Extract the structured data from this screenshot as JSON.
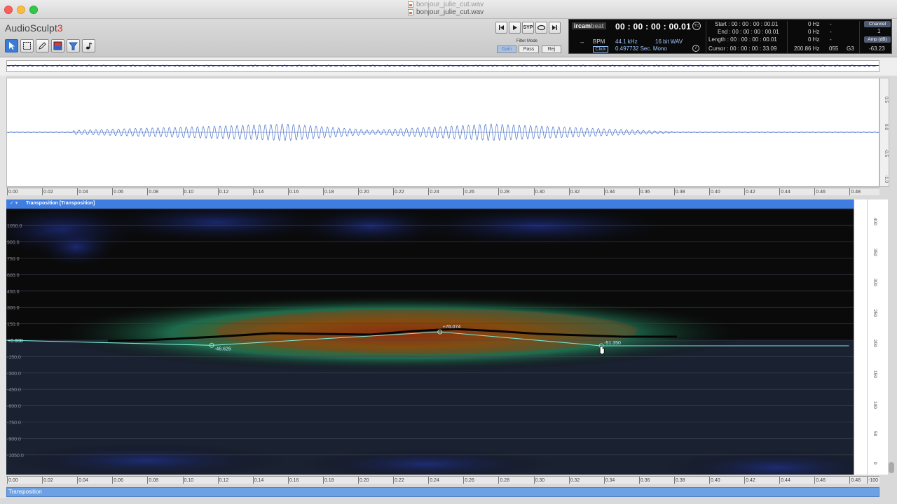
{
  "window": {
    "titles": [
      "bonjour_julie_cut.wav",
      "bonjour_julie_cut.wav"
    ]
  },
  "app": {
    "name": "AudioSculpt",
    "version": "3"
  },
  "toolbar": {
    "tools": [
      "select-arrow-icon",
      "rect-select-icon",
      "pencil-icon",
      "color-rect-icon",
      "filter-icon",
      "note-icon"
    ],
    "transport": [
      "skip-back-icon",
      "play-icon",
      "SYP",
      "loop-icon",
      "skip-forward-icon"
    ],
    "transport_labels": {
      "syp": "SYP"
    },
    "filter_mode": {
      "label": "Filter Mode",
      "buttons": [
        "Gain",
        "Pass",
        "Rej"
      ],
      "active": "Gain"
    }
  },
  "display": {
    "brand": "ircam",
    "brand_suffix": "beat",
    "timecode": "00 : 00 : 00 : 00.01",
    "tc_badge": "TC",
    "bpm_dash": "--",
    "bpm_label": "BPM",
    "click_label": "Click",
    "sample_rate": "44.1 kHz",
    "bit_depth": "16 bit WAV",
    "duration": "0.497732 Sec. Mono",
    "start": "Start : 00 : 00 : 00 : 00.01",
    "end": "End : 00 : 00 : 00 : 00.01",
    "length": "Length : 00 : 00 : 00 : 00.01",
    "cursor": "Cursor : 00 : 00 : 00 : 33.09",
    "start_hz": "0 Hz",
    "end_hz": "0 Hz",
    "length_hz": "0 Hz",
    "cursor_hz": "200.86 Hz",
    "cursor_midi": "055",
    "cursor_note": "G3",
    "dash": "-",
    "channel_label": "Channel",
    "channel_value": "1",
    "amp_label": "Amp (dB)",
    "amp_value": "-63.23"
  },
  "waveform": {
    "scale_labels": [
      "0.5",
      "0.0",
      "-0.5",
      "-1.0"
    ]
  },
  "time_ruler": [
    "0.00",
    "0.02",
    "0.04",
    "0.06",
    "0.08",
    "0.10",
    "0.12",
    "0.14",
    "0.16",
    "0.18",
    "0.20",
    "0.22",
    "0.24",
    "0.26",
    "0.28",
    "0.30",
    "0.32",
    "0.34",
    "0.36",
    "0.38",
    "0.40",
    "0.42",
    "0.44",
    "0.46",
    "0.48"
  ],
  "bottom_ruler": [
    "0.00",
    "0.02",
    "0.04",
    "0.06",
    "0.08",
    "0.10",
    "0.12",
    "0.14",
    "0.16",
    "0.18",
    "0.20",
    "0.22",
    "0.24",
    "0.26",
    "0.28",
    "0.30",
    "0.32",
    "0.34",
    "0.36",
    "0.38",
    "0.40",
    "0.42",
    "0.44",
    "0.46",
    "0.48",
    "-100"
  ],
  "spectrogram": {
    "header_label": "Transposition [Transposition]",
    "y_labels": [
      "1050.0",
      "900.0",
      "750.0",
      "600.0",
      "450.0",
      "300.0",
      "150.0",
      "+0.000",
      "-150.0",
      "-300.0",
      "-450.0",
      "-600.0",
      "-750.0",
      "-900.0",
      "-1050.0"
    ],
    "right_scale": [
      "400",
      "350",
      "300",
      "250",
      "200",
      "150",
      "100",
      "50",
      "0"
    ],
    "breakpoints": [
      {
        "t": 0.0,
        "cents": 0.0,
        "label": "+0.000"
      },
      {
        "t": 0.117,
        "cents": -46.626,
        "label": "-46.626"
      },
      {
        "t": 0.247,
        "cents": 76.074,
        "label": "+76.074"
      },
      {
        "t": 0.339,
        "cents": -51.35,
        "label": "-51.350"
      },
      {
        "t": 0.48,
        "cents": -51.35,
        "label": ""
      }
    ],
    "line_color": "#7fe6d6"
  },
  "status": {
    "bottom_label": "Transposition"
  }
}
